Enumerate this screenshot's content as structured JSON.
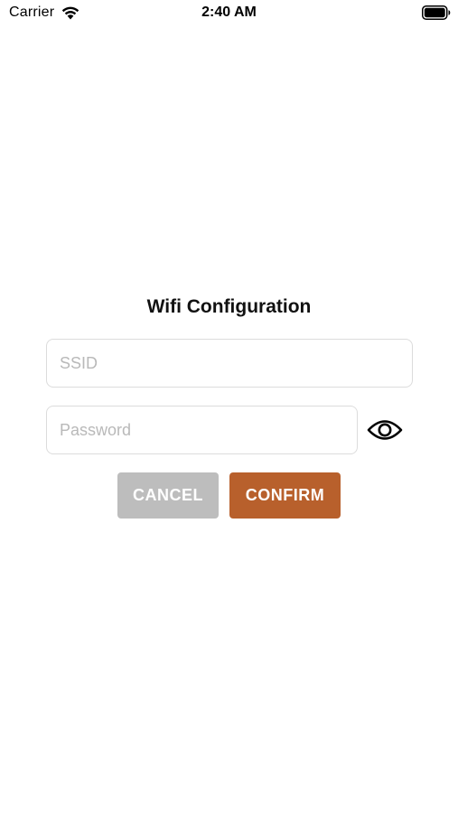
{
  "status_bar": {
    "carrier": "Carrier",
    "time": "2:40 AM",
    "icons": [
      "wifi-icon",
      "battery-icon"
    ]
  },
  "form": {
    "title": "Wifi Configuration",
    "ssid": {
      "value": "",
      "placeholder": "SSID"
    },
    "password": {
      "value": "",
      "placeholder": "Password",
      "toggle_icon": "eye-icon"
    },
    "cancel_label": "CANCEL",
    "confirm_label": "CONFIRM"
  },
  "colors": {
    "cancel_button": "#bdbdbd",
    "confirm_button": "#b8602c",
    "field_border": "#dcdcdc",
    "placeholder": "#b9b9b9"
  }
}
